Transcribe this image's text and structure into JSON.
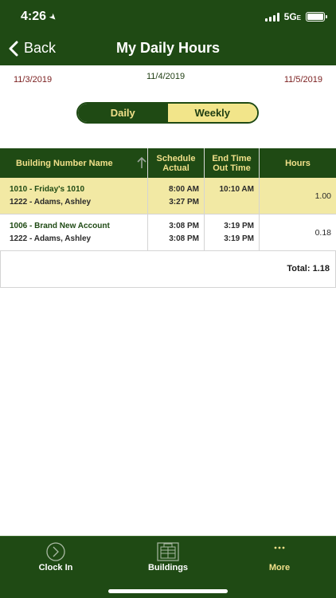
{
  "status_bar": {
    "time": "4:26",
    "network": "5G",
    "network_suffix": "E"
  },
  "nav": {
    "back_label": "Back",
    "title": "My Daily Hours"
  },
  "dates": {
    "prev": "11/3/2019",
    "current": "11/4/2019",
    "next": "11/5/2019"
  },
  "toggle": {
    "daily_label": "Daily",
    "weekly_label": "Weekly",
    "selected": "Weekly"
  },
  "table": {
    "headers": {
      "building": "Building Number Name",
      "schedule_line1": "Schedule",
      "schedule_line2": "Actual",
      "end_line1": "End Time",
      "end_line2": "Out Time",
      "hours": "Hours"
    },
    "rows": [
      {
        "building": "1010 - Friday's 1010",
        "employee": "1222 - Adams, Ashley",
        "schedule": "8:00 AM",
        "actual": "3:27 PM",
        "end_time": "10:10 AM",
        "out_time": "",
        "hours": "1.00"
      },
      {
        "building": "1006 - Brand New Account",
        "employee": "1222 - Adams, Ashley",
        "schedule": "3:08 PM",
        "actual": "3:08 PM",
        "end_time": "3:19 PM",
        "out_time": "3:19 PM",
        "hours": "0.18"
      }
    ],
    "total": "Total: 1.18"
  },
  "tabbar": {
    "items": [
      {
        "label": "Clock In",
        "icon": "clock-in-icon"
      },
      {
        "label": "Buildings",
        "icon": "buildings-icon"
      },
      {
        "label": "More",
        "icon": "more-icon"
      }
    ],
    "active": "More"
  },
  "colors": {
    "brand_green": "#1f4a14",
    "accent_yellow": "#f1e08a",
    "highlight_row": "#f2e9a4",
    "date_red": "#7a1e1e"
  }
}
